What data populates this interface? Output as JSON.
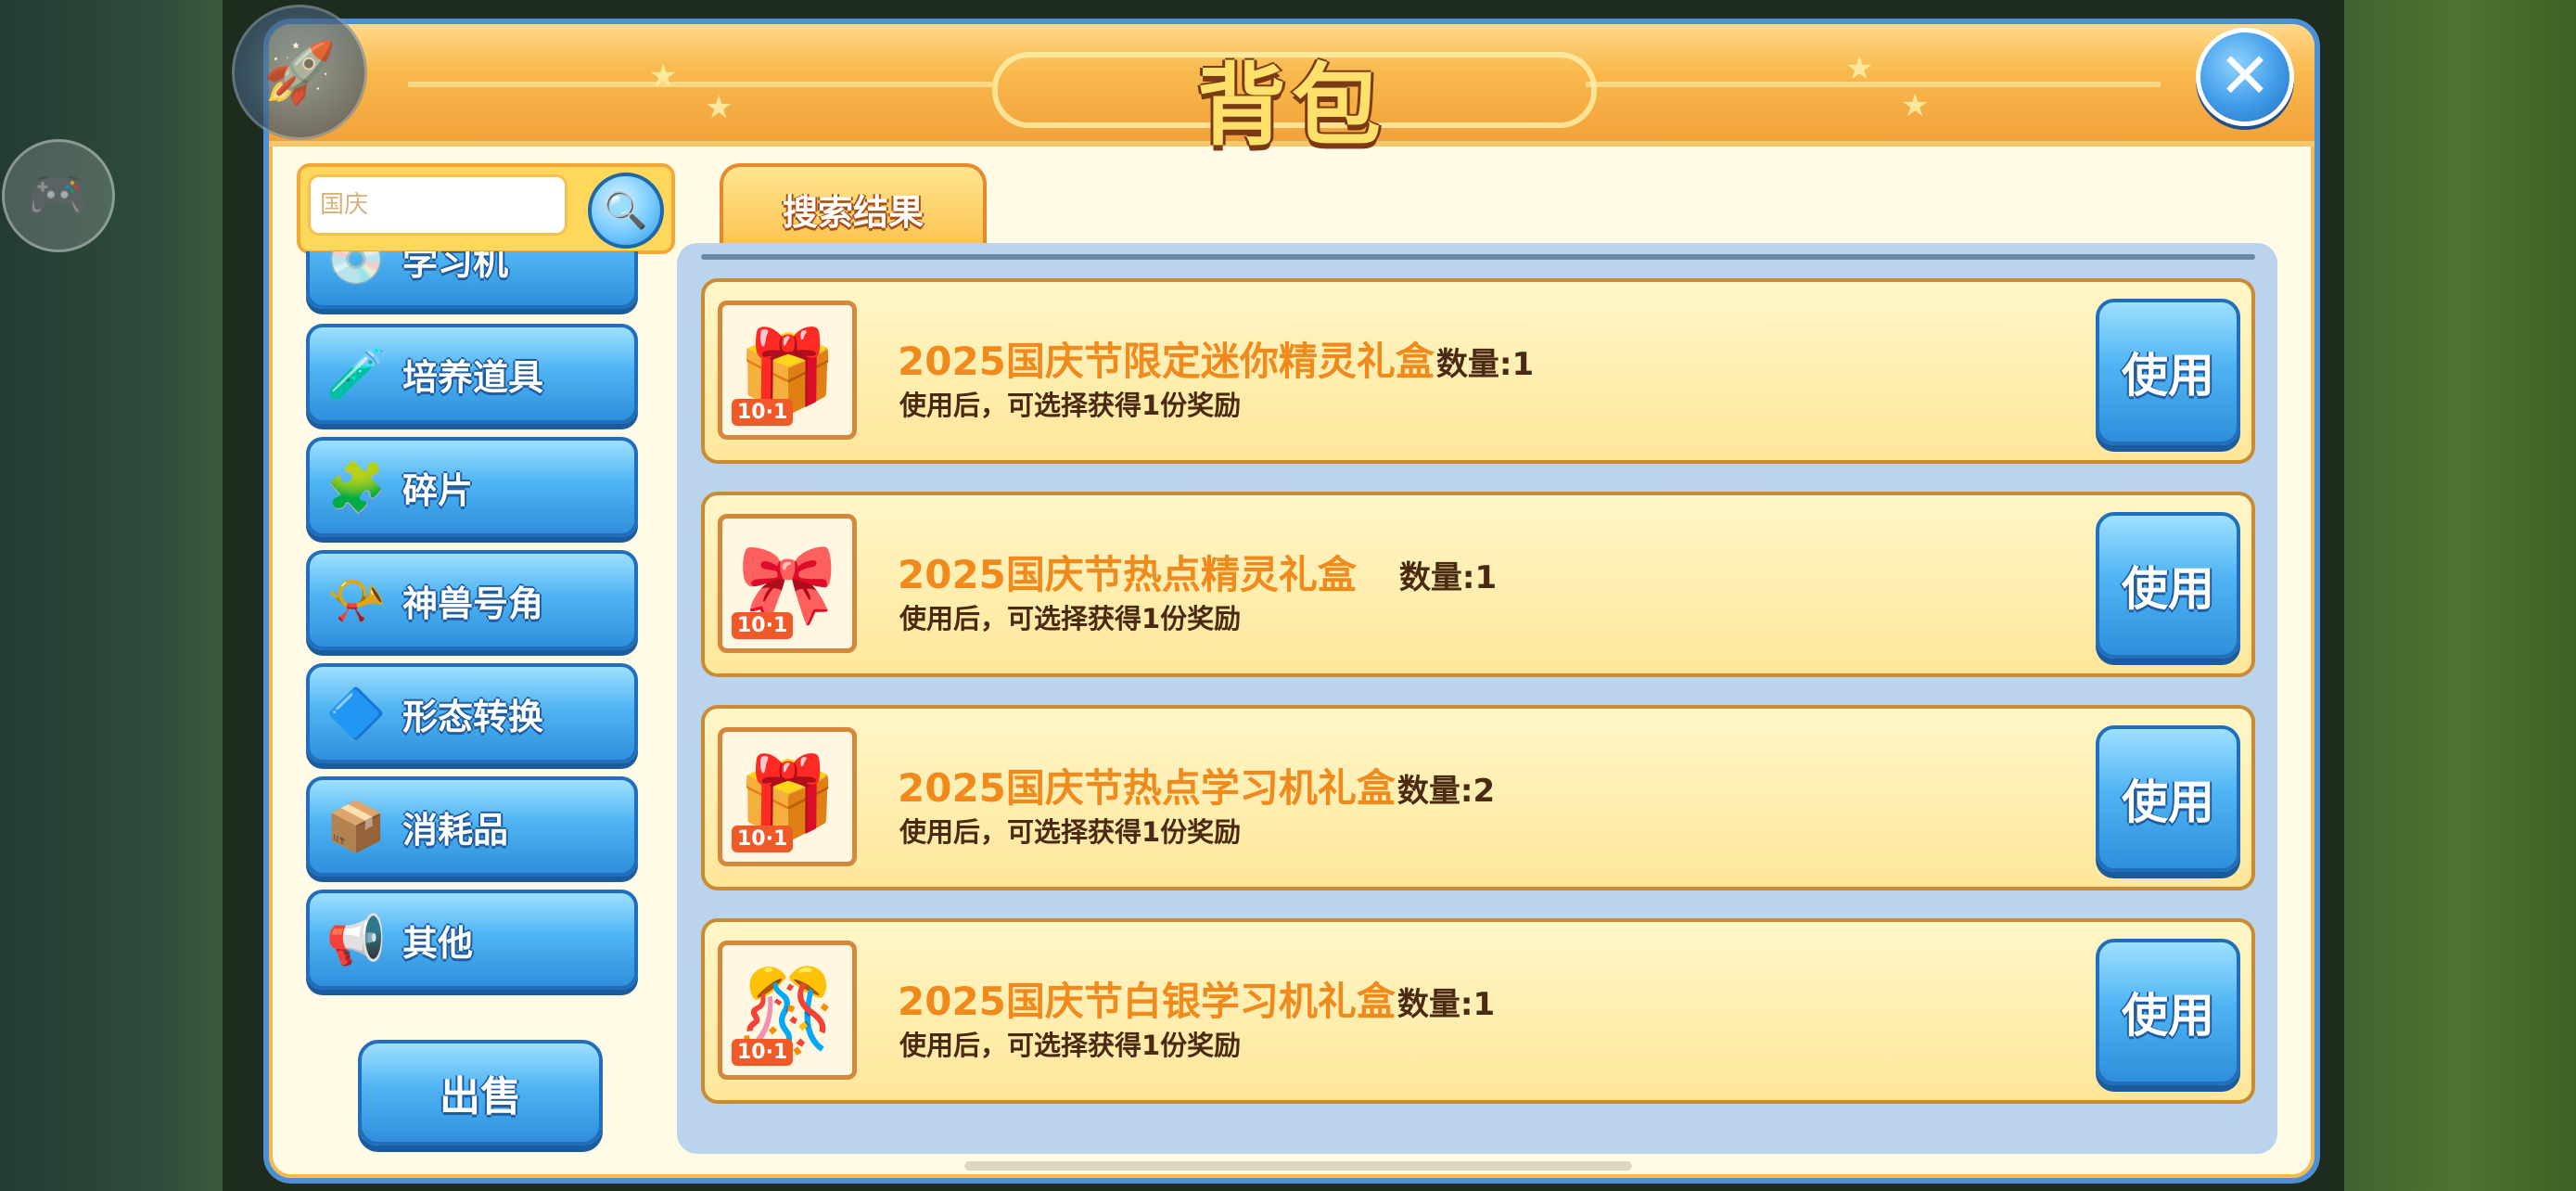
{
  "panel": {
    "title": "背包"
  },
  "search": {
    "value": "",
    "placeholder": "国庆"
  },
  "tab": {
    "label": "搜索结果"
  },
  "categories": [
    {
      "label": "学习机",
      "icon": "disc-icon"
    },
    {
      "label": "培养道具",
      "icon": "potion-icon"
    },
    {
      "label": "碎片",
      "icon": "puzzle-piece-icon"
    },
    {
      "label": "神兽号角",
      "icon": "horn-icon"
    },
    {
      "label": "形态转换",
      "icon": "crystal-icon"
    },
    {
      "label": "消耗品",
      "icon": "box-icon"
    },
    {
      "label": "其他",
      "icon": "megaphone-icon"
    }
  ],
  "sell_label": "出售",
  "items": [
    {
      "name": "2025国庆节限定迷你精灵礼盒",
      "qty": "数量:1",
      "desc": "使用后，可选择获得1份奖励",
      "badge": "10·1",
      "use_label": "使用"
    },
    {
      "name": "2025国庆节热点精灵礼盒",
      "qty": "数量:1",
      "desc": "使用后，可选择获得1份奖励",
      "badge": "10·1",
      "use_label": "使用"
    },
    {
      "name": "2025国庆节热点学习机礼盒",
      "qty": "数量:2",
      "desc": "使用后，可选择获得1份奖励",
      "badge": "10·1",
      "use_label": "使用"
    },
    {
      "name": "2025国庆节白银学习机礼盒",
      "qty": "数量:1",
      "desc": "使用后，可选择获得1份奖励",
      "badge": "10·1",
      "use_label": "使用"
    }
  ],
  "colors": {
    "accent_blue": "#3f9be8",
    "header_orange": "#f9b94d",
    "item_name": "#f08a1c"
  }
}
